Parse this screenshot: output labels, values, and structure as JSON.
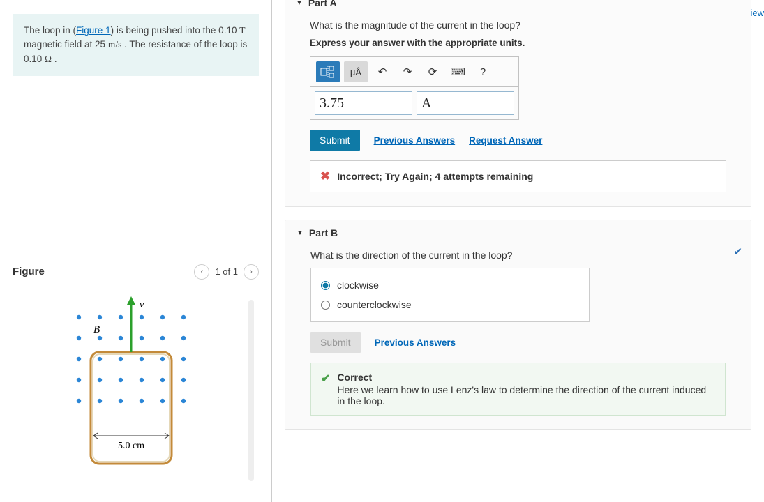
{
  "review_label": "Review",
  "problem": {
    "pre": "The loop in (",
    "figure_link": "Figure 1",
    "post1": ") is being pushed into the 0.10",
    "unit_T": "T",
    "post2": "magnetic field at 25",
    "unit_ms": "m/s",
    "post3": " . The resistance of the loop is 0.10",
    "unit_ohm": "Ω",
    "post4": " ."
  },
  "figure": {
    "heading": "Figure",
    "counter": "1 of 1",
    "label_B": "B",
    "label_v": "v",
    "width_label": "5.0 cm"
  },
  "partA": {
    "title": "Part A",
    "question": "What is the magnitude of the current in the loop?",
    "instruction": "Express your answer with the appropriate units.",
    "toolbar": {
      "template": "⬚¦⬚",
      "units_btn": "μÅ",
      "undo": "↶",
      "redo": "↷",
      "reset": "⟳",
      "keyboard": "⌨",
      "help": "?"
    },
    "value": "3.75",
    "unit": "A",
    "submit": "Submit",
    "prev_answers": "Previous Answers",
    "request_answer": "Request Answer",
    "feedback": "Incorrect; Try Again; 4 attempts remaining"
  },
  "partB": {
    "title": "Part B",
    "question": "What is the direction of the current in the loop?",
    "options": {
      "cw": "clockwise",
      "ccw": "counterclockwise"
    },
    "submit": "Submit",
    "prev_answers": "Previous Answers",
    "feedback_title": "Correct",
    "feedback_body": "Here we learn how to use Lenz's law to determine the direction of the current induced in the loop."
  }
}
